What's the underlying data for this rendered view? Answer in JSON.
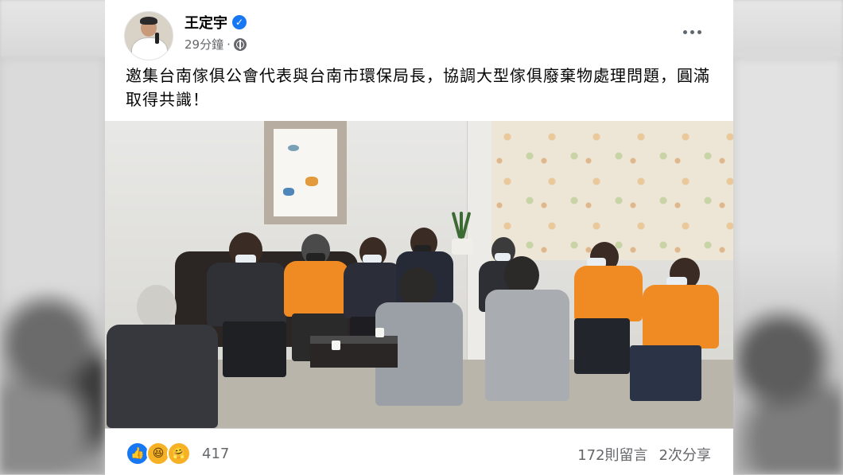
{
  "post": {
    "author_name": "王定宇",
    "timestamp": "29分鐘",
    "privacy_separator": "·",
    "privacy_icon": "globe-icon",
    "verified_icon": "verified-badge-icon",
    "options_icon": "more-options-icon",
    "message": "邀集台南傢俱公會代表與台南市環保局長，協調大型傢俱廢棄物處理問題，圓滿取得共識！"
  },
  "reactions": {
    "icons": [
      "like-icon",
      "haha-icon",
      "care-icon"
    ],
    "total": "417"
  },
  "stats": {
    "comments": "172則留言",
    "shares": "2次分享"
  },
  "colors": {
    "accent": "#1877f2",
    "text_primary": "#050505",
    "text_secondary": "#65676b",
    "vest_orange": "#f08a22"
  }
}
